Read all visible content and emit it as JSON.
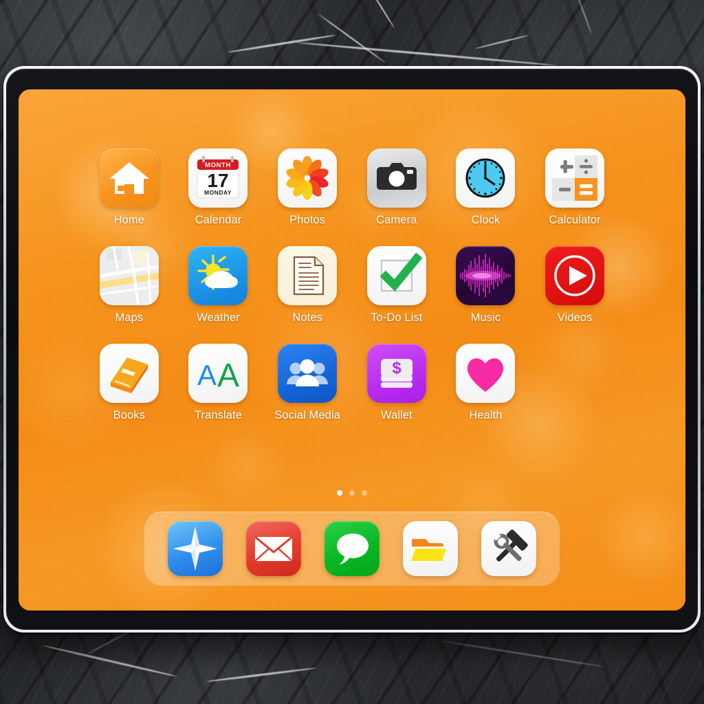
{
  "device": {
    "type": "tablet",
    "orientation": "landscape"
  },
  "wallpaper": {
    "accent": "#f7961f",
    "description": "orange bokeh"
  },
  "homescreen": {
    "apps": [
      {
        "label": "Home",
        "icon": "house-icon",
        "tile": "t-home"
      },
      {
        "label": "Calendar",
        "icon": "calendar-icon",
        "tile": "t-white"
      },
      {
        "label": "Photos",
        "icon": "photos-flower-icon",
        "tile": "t-white"
      },
      {
        "label": "Camera",
        "icon": "camera-icon",
        "tile": "t-cam"
      },
      {
        "label": "Clock",
        "icon": "clock-icon",
        "tile": "t-white"
      },
      {
        "label": "Calculator",
        "icon": "calculator-icon",
        "tile": "t-white"
      },
      {
        "label": "Maps",
        "icon": "map-icon",
        "tile": "t-white"
      },
      {
        "label": "Weather",
        "icon": "sun-cloud-icon",
        "tile": "t-weather"
      },
      {
        "label": "Notes",
        "icon": "note-page-icon",
        "tile": "t-cream"
      },
      {
        "label": "To-Do List",
        "icon": "checkmark-box-icon",
        "tile": "t-white"
      },
      {
        "label": "Music",
        "icon": "waveform-icon",
        "tile": "t-music"
      },
      {
        "label": "Videos",
        "icon": "play-circle-icon",
        "tile": "t-video"
      },
      {
        "label": "Books",
        "icon": "book-icon",
        "tile": "t-white"
      },
      {
        "label": "Translate",
        "icon": "double-a-icon",
        "tile": "t-white"
      },
      {
        "label": "Social Media",
        "icon": "people-group-icon",
        "tile": "t-social"
      },
      {
        "label": "Wallet",
        "icon": "money-stack-icon",
        "tile": "t-wallet"
      },
      {
        "label": "Health",
        "icon": "heart-icon",
        "tile": "t-white"
      }
    ],
    "calendar_icon": {
      "banner": "MONTH",
      "day_number": "17",
      "weekday": "MONDAY"
    },
    "translate_icon": {
      "left_letter": "A",
      "right_letter": "A",
      "left_color": "#1b8ce8",
      "right_color": "#16a34a"
    },
    "wallet_icon": {
      "symbol": "$"
    },
    "calculator_icon": {
      "keys": [
        "+",
        "÷",
        "−",
        "="
      ],
      "accent": "#f7931e"
    },
    "page_indicator": {
      "total": 3,
      "active": 1
    }
  },
  "dock": {
    "apps": [
      {
        "name": "Safari",
        "icon": "compass-star-icon",
        "tile": "d-safari"
      },
      {
        "name": "Mail",
        "icon": "envelope-icon",
        "tile": "d-mail"
      },
      {
        "name": "Messages",
        "icon": "speech-bubble-icon",
        "tile": "d-msg"
      },
      {
        "name": "Files",
        "icon": "folder-icon",
        "tile": "d-files"
      },
      {
        "name": "Tools",
        "icon": "hammer-wrench-icon",
        "tile": "d-tools"
      }
    ]
  }
}
